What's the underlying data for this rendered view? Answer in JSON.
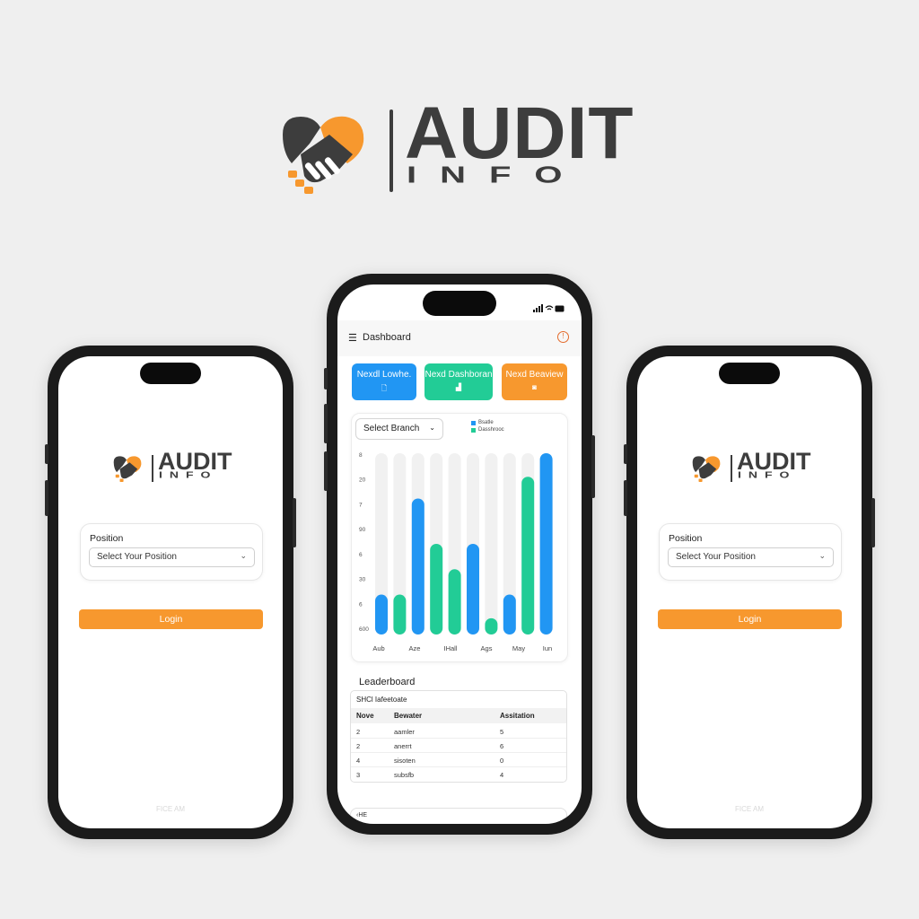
{
  "brand": {
    "name_line1": "AUDIT",
    "name_line2": "INFO",
    "colors": {
      "orange": "#f7982e",
      "dark": "#3d3d3d",
      "blue": "#2196f3",
      "green": "#22cc96"
    }
  },
  "login_screen": {
    "position_label": "Position",
    "position_select_value": "Select Your Position",
    "login_button": "Login",
    "footer": "FICE AM"
  },
  "dashboard": {
    "header_icon": "menu-icon",
    "menu_glyph": "☰",
    "title": "Dashboard",
    "alert_glyph": "!",
    "quick_actions": [
      {
        "label": "Nexdl Lowhe.",
        "icon": "document-icon",
        "glyph": "🗋"
      },
      {
        "label": "Nexd Dashboran",
        "icon": "chart-icon",
        "glyph": "▟"
      },
      {
        "label": "Nexd Beaview",
        "icon": "review-icon",
        "glyph": "◙"
      }
    ],
    "branch_select": "Select Branch",
    "leaderboard_title": "Leaderboard",
    "leaderboard_subtitle": "SHCl Iafeetoate",
    "bottom_bar_text": "‹HE"
  },
  "chart_data": {
    "type": "bar",
    "legend": [
      "Bsatle",
      "Dasshrooc"
    ],
    "y_tick_labels": [
      "8",
      "20",
      "7",
      "90",
      "6",
      "30",
      "6",
      "600"
    ],
    "x_tick_labels": [
      "Aub",
      "Aze",
      "IHall",
      "Ags",
      "May",
      "Iun"
    ],
    "bars": [
      {
        "series": "Bsatle",
        "value": 0.22
      },
      {
        "series": "Dasshrooc",
        "value": 0.22
      },
      {
        "series": "Bsatle",
        "value": 0.75
      },
      {
        "series": "Dasshrooc",
        "value": 0.5
      },
      {
        "series": "Dasshrooc",
        "value": 0.36
      },
      {
        "series": "Bsatle",
        "value": 0.5
      },
      {
        "series": "Dasshrooc",
        "value": 0.09
      },
      {
        "series": "Bsatle",
        "value": 0.22
      },
      {
        "series": "Dasshrooc",
        "value": 0.87
      },
      {
        "series": "Bsatle",
        "value": 1.0
      }
    ],
    "series_colors": {
      "Bsatle": "#2196f3",
      "Dasshrooc": "#22cc96"
    },
    "value_scale": "fraction of full height"
  },
  "leaderboard": {
    "columns": [
      "Nove",
      "Bewater",
      "Assitation"
    ],
    "rows": [
      [
        "2",
        "aamler",
        "5"
      ],
      [
        "2",
        "anerrt",
        "6"
      ],
      [
        "4",
        "sisoten",
        "0"
      ],
      [
        "3",
        "subsfb",
        "4"
      ]
    ]
  }
}
